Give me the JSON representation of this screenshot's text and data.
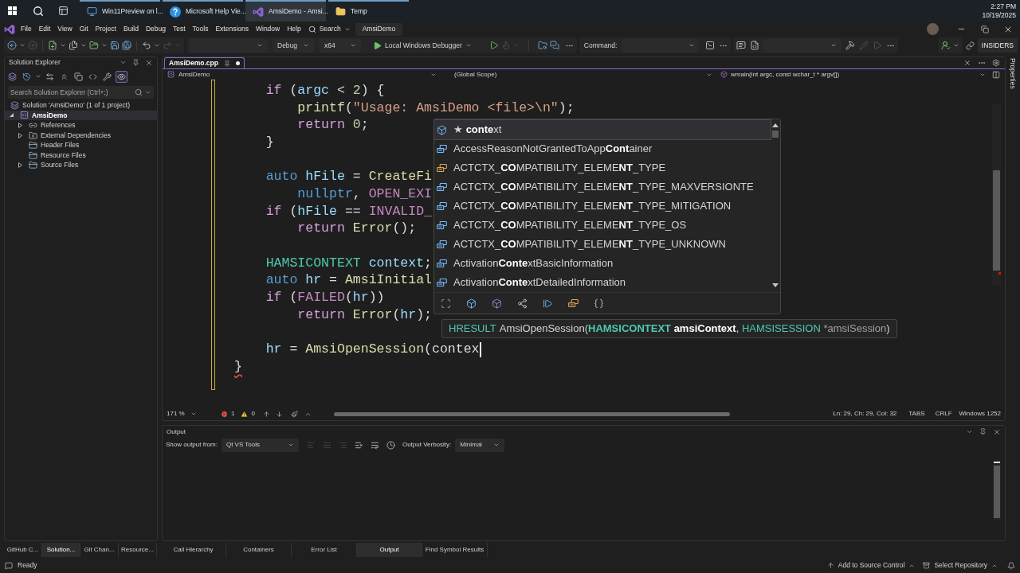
{
  "taskbar": {
    "apps": [
      {
        "label": "Win11Preview on l...",
        "kind": "remote",
        "selected": false
      },
      {
        "label": "Microsoft Help Vie...",
        "kind": "help",
        "selected": false
      },
      {
        "label": "AmsiDemo - Amsi...",
        "kind": "ide",
        "selected": true
      },
      {
        "label": "Temp",
        "kind": "folder",
        "selected": false
      }
    ],
    "time": "2:27 PM",
    "date": "10/19/2025"
  },
  "menu_bar": {
    "items": [
      "File",
      "Edit",
      "View",
      "Git",
      "Project",
      "Build",
      "Debug",
      "Test",
      "Tools",
      "Extensions",
      "Window",
      "Help"
    ],
    "search": "Search",
    "solution": "AmsiDemo"
  },
  "toolbar": {
    "buttons": [
      {
        "kind": "back",
        "disabled": false
      },
      {
        "kind": "forward",
        "disabled": true
      },
      {
        "kind": "new-project",
        "disabled": false
      },
      {
        "kind": "add-item",
        "disabled": false
      },
      {
        "kind": "open",
        "disabled": false
      },
      {
        "kind": "save",
        "disabled": false
      },
      {
        "kind": "save-all",
        "disabled": false
      },
      {
        "kind": "undo",
        "disabled": false
      },
      {
        "kind": "redo",
        "disabled": true
      }
    ],
    "configuration": "Debug",
    "platform": "x64",
    "debug_target": "Local Windows Debugger",
    "run_buttons": [
      {
        "kind": "start",
        "disabled": false
      },
      {
        "kind": "hot-reload",
        "disabled": true
      },
      {
        "kind": "find",
        "disabled": false
      },
      {
        "kind": "comments",
        "disabled": false
      }
    ],
    "command_label": "Command:",
    "extra_buttons": [
      {
        "kind": "chat",
        "disabled": false
      },
      {
        "kind": "document",
        "disabled": false
      },
      {
        "kind": "build",
        "disabled": false
      },
      {
        "kind": "edit",
        "disabled": true
      },
      {
        "kind": "run",
        "disabled": true
      }
    ],
    "badge": "INSIDERS"
  },
  "solution_explorer": {
    "title": "Solution Explorer",
    "tools": [
      {
        "kind": "views",
        "selected": false
      },
      {
        "kind": "history",
        "selected": false
      },
      {
        "kind": "sync",
        "selected": false
      },
      {
        "kind": "collapse",
        "selected": false
      },
      {
        "kind": "copy",
        "selected": false
      },
      {
        "kind": "code",
        "selected": false
      },
      {
        "kind": "properties",
        "selected": false
      },
      {
        "kind": "preview",
        "selected": true
      }
    ],
    "search": {
      "placeholder": "Search Solution Explorer (Ctrl+;)"
    },
    "tree": [
      {
        "label": "Solution 'AmsiDemo' (1 of 1 project)",
        "kind": "solution",
        "selected": false,
        "bold": false,
        "children": [
          {
            "label": "AmsiDemo",
            "kind": "project",
            "expanded": true,
            "selected": true,
            "bold": true,
            "children": [
              {
                "label": "References",
                "kind": "references",
                "expanded": false,
                "selected": false,
                "bold": false
              },
              {
                "label": "External Dependencies",
                "kind": "dependencies",
                "expanded": false,
                "selected": false,
                "bold": false
              },
              {
                "label": "Header Files",
                "kind": "filter",
                "selected": false,
                "bold": false
              },
              {
                "label": "Resource Files",
                "kind": "filter",
                "selected": false,
                "bold": false
              },
              {
                "label": "Source Files",
                "kind": "filter",
                "expanded": false,
                "selected": false,
                "bold": false
              }
            ]
          }
        ]
      }
    ]
  },
  "editor": {
    "tabs": [
      {
        "label": "AmsiDemo.cpp",
        "selected": true,
        "modified": true
      }
    ],
    "nav": {
      "project": "AmsiDemo",
      "scope": "(Global Scope)",
      "member": "wmain(int argc, const wchar_t * argv[])"
    },
    "body": [
      {
        "kind": "code",
        "error": false,
        "cursor": false,
        "tokens": [
          {
            "text": "if",
            "kind": "control"
          },
          {
            "text": " (",
            "kind": "plain"
          },
          {
            "text": "argc",
            "kind": "param"
          },
          {
            "text": " < ",
            "kind": "plain"
          },
          {
            "text": "2",
            "kind": "number"
          },
          {
            "text": ") {",
            "kind": "plain"
          }
        ],
        "children": [
          {
            "kind": "code",
            "error": false,
            "cursor": false,
            "tokens": [
              {
                "text": "printf",
                "kind": "function"
              },
              {
                "text": "(",
                "kind": "plain"
              },
              {
                "text": "\"Usage: AmsiDemo <file>\\n\"",
                "kind": "string"
              },
              {
                "text": ");",
                "kind": "plain"
              }
            ]
          },
          {
            "kind": "code",
            "error": false,
            "cursor": false,
            "tokens": [
              {
                "text": "return",
                "kind": "control"
              },
              {
                "text": " 0",
                "kind": "number"
              },
              {
                "text": ";",
                "kind": "plain"
              }
            ]
          }
        ]
      },
      {
        "kind": "code",
        "error": false,
        "cursor": false,
        "tokens": [
          {
            "text": "}",
            "kind": "plain"
          }
        ]
      },
      {
        "kind": "blank"
      },
      {
        "kind": "code",
        "error": false,
        "cursor": false,
        "tokens": [
          {
            "text": "auto",
            "kind": "keyword"
          },
          {
            "text": " hFile",
            "kind": "local"
          },
          {
            "text": " = ",
            "kind": "plain"
          },
          {
            "text": "CreateFi",
            "kind": "function"
          }
        ],
        "children": [
          {
            "kind": "code",
            "error": false,
            "cursor": false,
            "tokens": [
              {
                "text": "nullptr",
                "kind": "keyword"
              },
              {
                "text": ", ",
                "kind": "plain"
              },
              {
                "text": "OPEN_EXI",
                "kind": "macro"
              }
            ]
          }
        ]
      },
      {
        "kind": "code",
        "error": false,
        "cursor": false,
        "tokens": [
          {
            "text": "if",
            "kind": "control"
          },
          {
            "text": " (",
            "kind": "plain"
          },
          {
            "text": "hFile",
            "kind": "local"
          },
          {
            "text": " == ",
            "kind": "plain"
          },
          {
            "text": "INVALID_",
            "kind": "macro"
          }
        ],
        "children": [
          {
            "kind": "code",
            "error": false,
            "cursor": false,
            "tokens": [
              {
                "text": "return",
                "kind": "control"
              },
              {
                "text": " Error",
                "kind": "function"
              },
              {
                "text": "();",
                "kind": "plain"
              }
            ]
          }
        ]
      },
      {
        "kind": "blank"
      },
      {
        "kind": "code",
        "error": false,
        "cursor": false,
        "tokens": [
          {
            "text": "HAMSICONTEXT",
            "kind": "type"
          },
          {
            "text": " context",
            "kind": "local"
          },
          {
            "text": ";",
            "kind": "plain"
          }
        ]
      },
      {
        "kind": "code",
        "error": false,
        "cursor": false,
        "tokens": [
          {
            "text": "auto",
            "kind": "keyword"
          },
          {
            "text": " hr",
            "kind": "local"
          },
          {
            "text": " = ",
            "kind": "plain"
          },
          {
            "text": "AmsiInitial",
            "kind": "function"
          }
        ]
      },
      {
        "kind": "code",
        "error": false,
        "cursor": false,
        "tokens": [
          {
            "text": "if",
            "kind": "control"
          },
          {
            "text": " (",
            "kind": "plain"
          },
          {
            "text": "FAILED",
            "kind": "macro"
          },
          {
            "text": "(",
            "kind": "plain"
          },
          {
            "text": "hr",
            "kind": "local"
          },
          {
            "text": "))",
            "kind": "plain"
          }
        ],
        "children": [
          {
            "kind": "code",
            "error": false,
            "cursor": false,
            "tokens": [
              {
                "text": "return",
                "kind": "control"
              },
              {
                "text": " Error",
                "kind": "function"
              },
              {
                "text": "(",
                "kind": "plain"
              },
              {
                "text": "hr",
                "kind": "local"
              },
              {
                "text": ");",
                "kind": "plain"
              }
            ]
          }
        ]
      },
      {
        "kind": "blank"
      },
      {
        "kind": "code",
        "error": false,
        "cursor": true,
        "tokens": [
          {
            "text": "hr",
            "kind": "local"
          },
          {
            "text": " = ",
            "kind": "plain"
          },
          {
            "text": "AmsiOpenSession",
            "kind": "function"
          },
          {
            "text": "(",
            "kind": "plain"
          },
          {
            "text": "contex",
            "kind": "plain"
          }
        ]
      }
    ],
    "closing_line": {
      "error": true,
      "cursor": false,
      "tokens": [
        {
          "text": "}",
          "kind": "plain"
        }
      ]
    },
    "completion": {
      "items": [
        {
          "label": "★ **conte**xt",
          "kind": "variable",
          "selected": true
        },
        {
          "label": "AccessReasonNotGrantedToApp**Cont**ainer",
          "kind": "enumerator",
          "selected": false
        },
        {
          "label": "ACTCTX_**CO**MPATIBILITY_ELEME**NT**_TYPE",
          "kind": "enum",
          "selected": false
        },
        {
          "label": "ACTCTX_**CO**MPATIBILITY_ELEME**NT**_TYPE_MAXVERSIONTE",
          "kind": "enumerator",
          "selected": false
        },
        {
          "label": "ACTCTX_**CO**MPATIBILITY_ELEME**NT**_TYPE_MITIGATION",
          "kind": "enumerator",
          "selected": false
        },
        {
          "label": "ACTCTX_**CO**MPATIBILITY_ELEME**NT**_TYPE_OS",
          "kind": "enumerator",
          "selected": false
        },
        {
          "label": "ACTCTX_**CO**MPATIBILITY_ELEME**NT**_TYPE_UNKNOWN",
          "kind": "enumerator",
          "selected": false
        },
        {
          "label": "Activation**Conte**xtBasicInformation",
          "kind": "enumerator",
          "selected": false
        },
        {
          "label": "Activation**Conte**xtDetailedInformation",
          "kind": "enumerator",
          "selected": false
        }
      ]
    },
    "signature": {
      "return_type": "HRESULT",
      "function": "AmsiOpenSession(",
      "params": [
        {
          "type": "HAMSICONTEXT",
          "name": "amsiContext",
          "suffix": ", ",
          "selected": true
        },
        {
          "type": "HAMSISESSION",
          "name": "*amsiSession",
          "suffix": ")",
          "selected": false
        }
      ]
    },
    "status": {
      "zoom": "171 %",
      "errors": "1",
      "warnings": "0",
      "position": "Ln: 29, Ch: 29, Col: 32",
      "indentation": "TABS",
      "line_endings": "CRLF",
      "encoding": "Windows 1252"
    }
  },
  "properties_tab": {
    "label": "Properties"
  },
  "output": {
    "title": "Output",
    "source_label": "Show output from:",
    "source": "Qt VS Tools",
    "tools": [
      {
        "kind": "find-message",
        "disabled": true
      },
      {
        "kind": "previous",
        "disabled": true
      },
      {
        "kind": "next",
        "disabled": true
      },
      {
        "kind": "clear",
        "disabled": false
      },
      {
        "kind": "word-wrap",
        "disabled": false
      },
      {
        "kind": "timestamps",
        "disabled": false
      }
    ],
    "verbosity_label": "Output Verbosity:",
    "verbosity": "Minimal"
  },
  "tool_tabs": {
    "side": [
      {
        "label": "GitHub C...",
        "selected": false
      },
      {
        "label": "Solution...",
        "selected": true
      },
      {
        "label": "Git Chan...",
        "selected": false
      },
      {
        "label": "Resource...",
        "selected": false
      }
    ],
    "bottom": [
      {
        "label": "Call Hierarchy",
        "selected": false
      },
      {
        "label": "Containers",
        "selected": false
      },
      {
        "label": "Error List",
        "selected": false
      },
      {
        "label": "Output",
        "selected": true
      },
      {
        "label": "Find Symbol Results",
        "selected": false
      }
    ]
  },
  "status_bar": {
    "text": "Ready",
    "source_control": "Add to Source Control",
    "repository": "Select Repository"
  }
}
